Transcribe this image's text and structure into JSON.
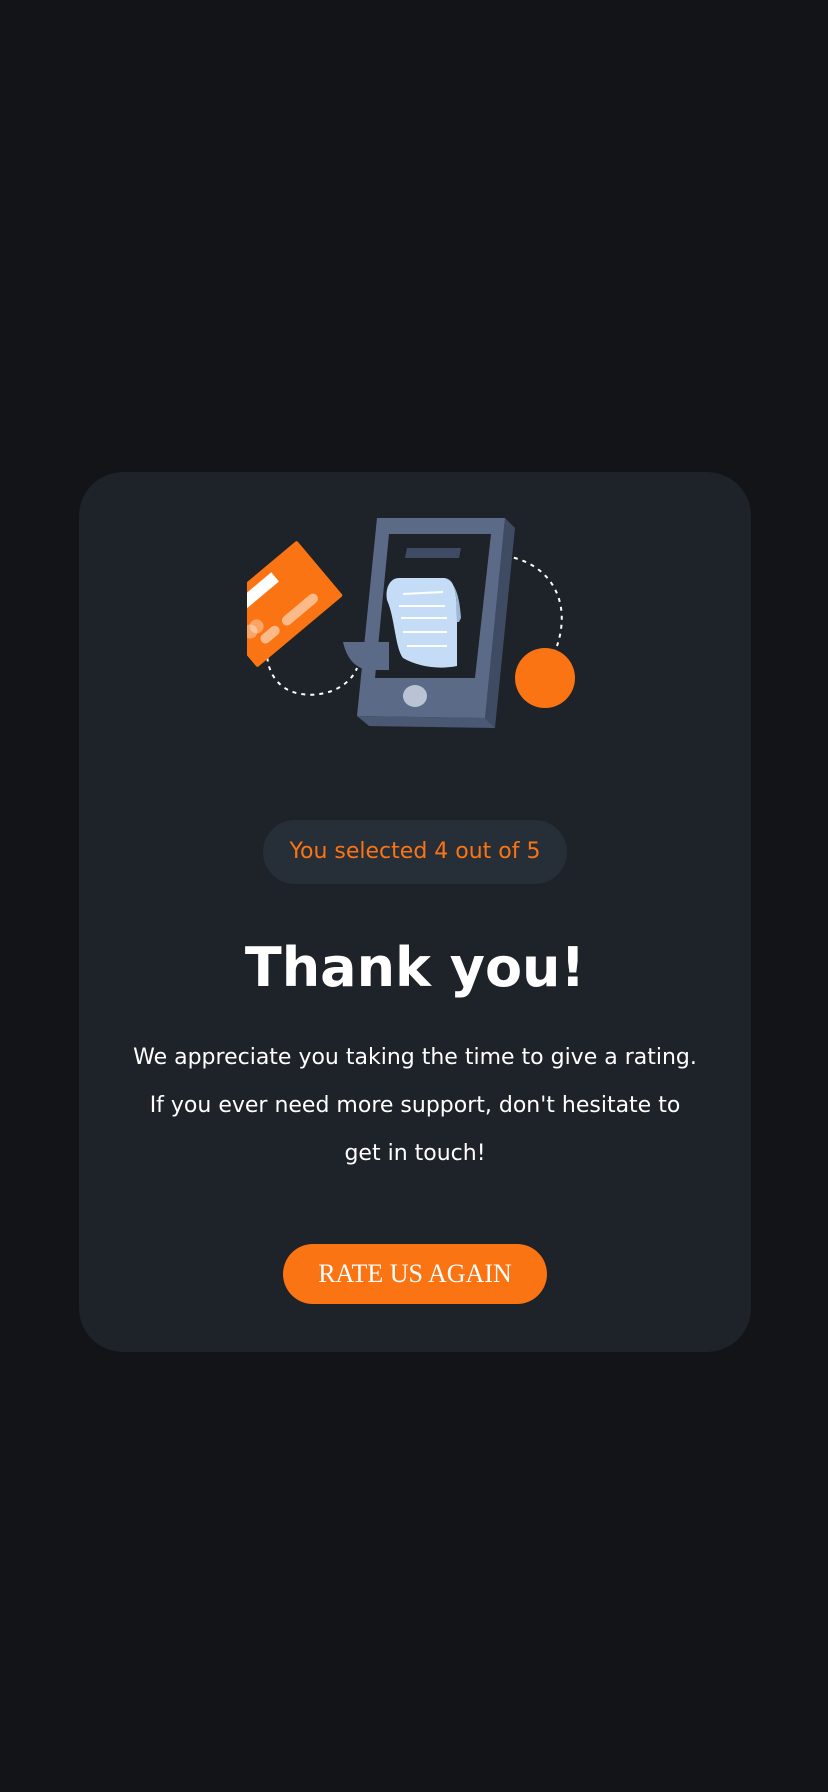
{
  "colors": {
    "page_background": "#121417",
    "card_background": "#1e2229",
    "pill_background": "#262e38",
    "accent_orange": "#fb7413",
    "text_white": "#ffffff",
    "phone_body": "#5b6b87",
    "phone_screen": "#1e2229",
    "receipt": "#c5dcf7"
  },
  "illustration": {
    "icon": "card-payment-phone-illustration"
  },
  "selection": {
    "text": "You selected 4 out of 5",
    "rating": 4,
    "max_rating": 5
  },
  "thankyou": {
    "title": "Thank you!",
    "lines": [
      "We appreciate you taking the time to give a rating.",
      "If you ever need more support, don't hesitate to",
      "get in touch!"
    ]
  },
  "actions": {
    "rate_again_label": "RATE US AGAIN"
  }
}
